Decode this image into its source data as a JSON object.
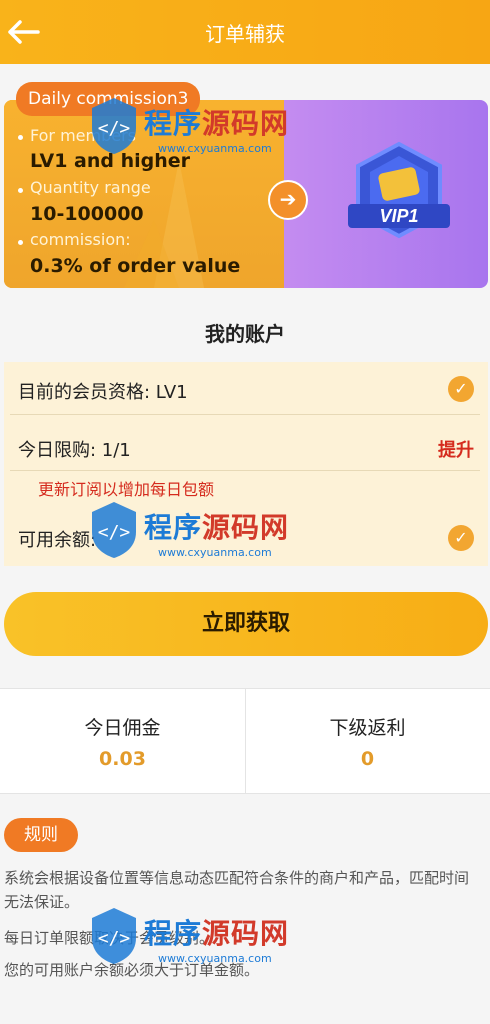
{
  "header": {
    "title": "订单辅获"
  },
  "banner": {
    "tag": "Daily commission3",
    "member_label": "For members",
    "member_value": "LV1 and higher",
    "qty_label": "Quantity range",
    "qty_value": "10-100000",
    "comm_label": "commission:",
    "comm_value": "0.3% of order value",
    "badge": "VIP1"
  },
  "account": {
    "title": "我的账户",
    "membership": "目前的会员资格: LV1",
    "limit": "今日限购: 1/1",
    "upgrade": "提升",
    "warning": "更新订阅以增加每日包额",
    "balance": "可用余额:"
  },
  "action": {
    "get": "立即获取"
  },
  "stats": [
    {
      "label": "今日佣金",
      "value": "0.03"
    },
    {
      "label": "下级返利",
      "value": "0"
    }
  ],
  "rules": {
    "label": "规则",
    "lines": [
      "系统会根据设备位置等信息动态匹配符合条件的商户和产品，匹配时间",
      "无法保证。",
      "每日订单限额取决于会员级别。",
      "您的可用账户余额必须大于订单金额。"
    ]
  },
  "watermark": {
    "cn_a": "程序",
    "cn_b": "源码网",
    "en": "www.cxyuanma.com"
  },
  "colors": {
    "accent": "#f9b31a",
    "warning": "#d52b1e"
  }
}
